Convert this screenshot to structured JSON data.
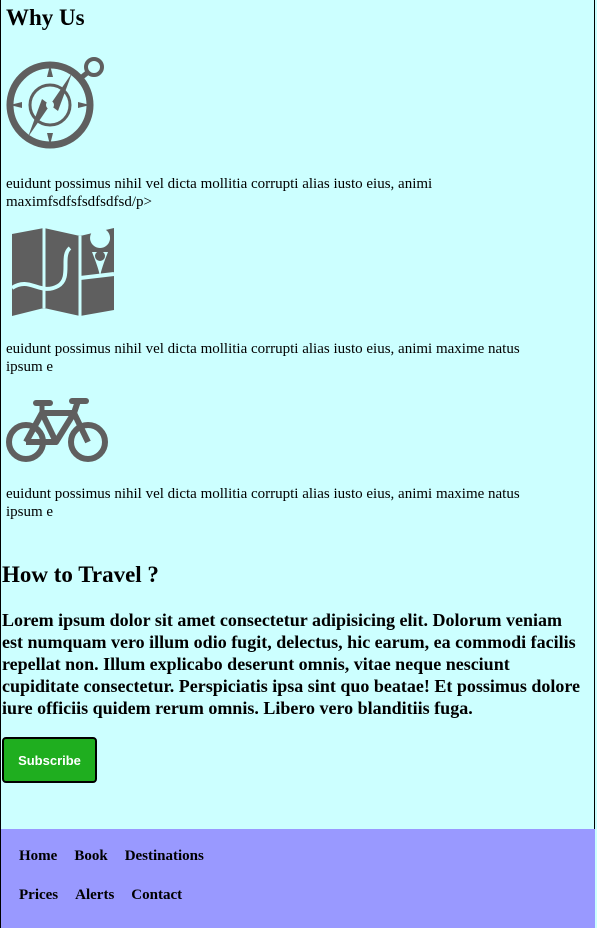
{
  "why_us": {
    "title": "Why Us",
    "features": [
      {
        "icon": "compass-icon",
        "text": "euidunt possimus nihil vel dicta mollitia corrupti alias iusto eius, animi maximfsdfsfsdfsdfsd/p>"
      },
      {
        "icon": "map-icon",
        "text": "euidunt possimus nihil vel dicta mollitia corrupti alias iusto eius, animi maxime natus ipsum e"
      },
      {
        "icon": "bicycle-icon",
        "text": "euidunt possimus nihil vel dicta mollitia corrupti alias iusto eius, animi maxime natus ipsum e"
      }
    ]
  },
  "how_to_travel": {
    "title": "How to Travel ?",
    "text": "Lorem ipsum dolor sit amet consectetur adipisicing elit. Dolorum veniam est numquam vero illum odio fugit, delectus, hic earum, ea commodi facilis repellat non. Illum explicabo deserunt omnis, vitae neque nesciunt cupiditate consectetur. Perspiciatis ipsa sint quo beatae! Et possimus dolore iure officiis quidem rerum omnis. Libero vero blanditiis fuga."
  },
  "subscribe_label": "Subscribe",
  "footer": {
    "row1": [
      "Home",
      "Book",
      "Destinations"
    ],
    "row2": [
      "Prices",
      "Alerts",
      "Contact"
    ]
  },
  "colors": {
    "page_bg": "#ccffff",
    "footer_bg": "#9999ff",
    "button_bg": "#1fae1f",
    "icon_gray": "#5f5f5f"
  }
}
